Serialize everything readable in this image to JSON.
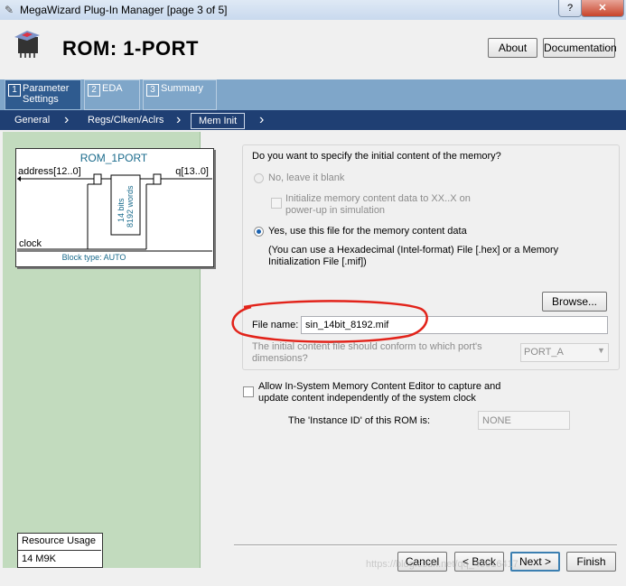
{
  "window": {
    "title": "MegaWizard Plug-In Manager [page 3 of 5]",
    "help_label": "?",
    "close_label": "✕"
  },
  "header": {
    "title": "ROM: 1-PORT",
    "about_label": "About",
    "documentation_label": "Documentation"
  },
  "tabs": [
    {
      "num": "1",
      "label_line1": "Parameter",
      "label_line2": "Settings"
    },
    {
      "num": "2",
      "label_line1": "EDA"
    },
    {
      "num": "3",
      "label_line1": "Summary"
    }
  ],
  "subtabs": [
    "General",
    "Regs/Clken/Aclrs",
    "Mem Init"
  ],
  "symbol": {
    "name": "ROM_1PORT",
    "address_port": "address[12..0]",
    "q_port": "q[13..0]",
    "clock_port": "clock",
    "bits": "14 bits",
    "words": "8192 words",
    "block_type": "Block type: AUTO"
  },
  "resource": {
    "title": "Resource Usage",
    "value": "14 M9K"
  },
  "mem_init": {
    "question": "Do you want to specify the initial content of the memory?",
    "option_no": "No, leave it blank",
    "init_checkbox": "Initialize memory content data to XX..X on power-up in simulation",
    "option_yes": "Yes, use this file for the memory content data",
    "hint": "(You can use a Hexadecimal (Intel-format) File [.hex] or a Memory Initialization File [.mif])",
    "browse_label": "Browse...",
    "file_label": "File name:",
    "file_value": "sin_14bit_8192.mif",
    "port_label": "The initial content file should conform to which port's dimensions?",
    "port_value": "PORT_A",
    "allow_label": "Allow In-System Memory Content Editor to capture and update content independently of the system clock",
    "instance_label": "The 'Instance ID' of this ROM is:",
    "instance_value": "NONE"
  },
  "footer": {
    "cancel": "Cancel",
    "back": "< Back",
    "next": "Next >",
    "finish": "Finish",
    "watermark": "https://blog.csdn.net/qq_43616417"
  },
  "colors": {
    "tab_active": "#2f5b8f",
    "subtab_bar": "#1f3f73",
    "left_panel": "#c2dbbe",
    "annotation": "#e2231a"
  },
  "icons": {
    "chip": "chip-icon",
    "window": "app-icon"
  }
}
